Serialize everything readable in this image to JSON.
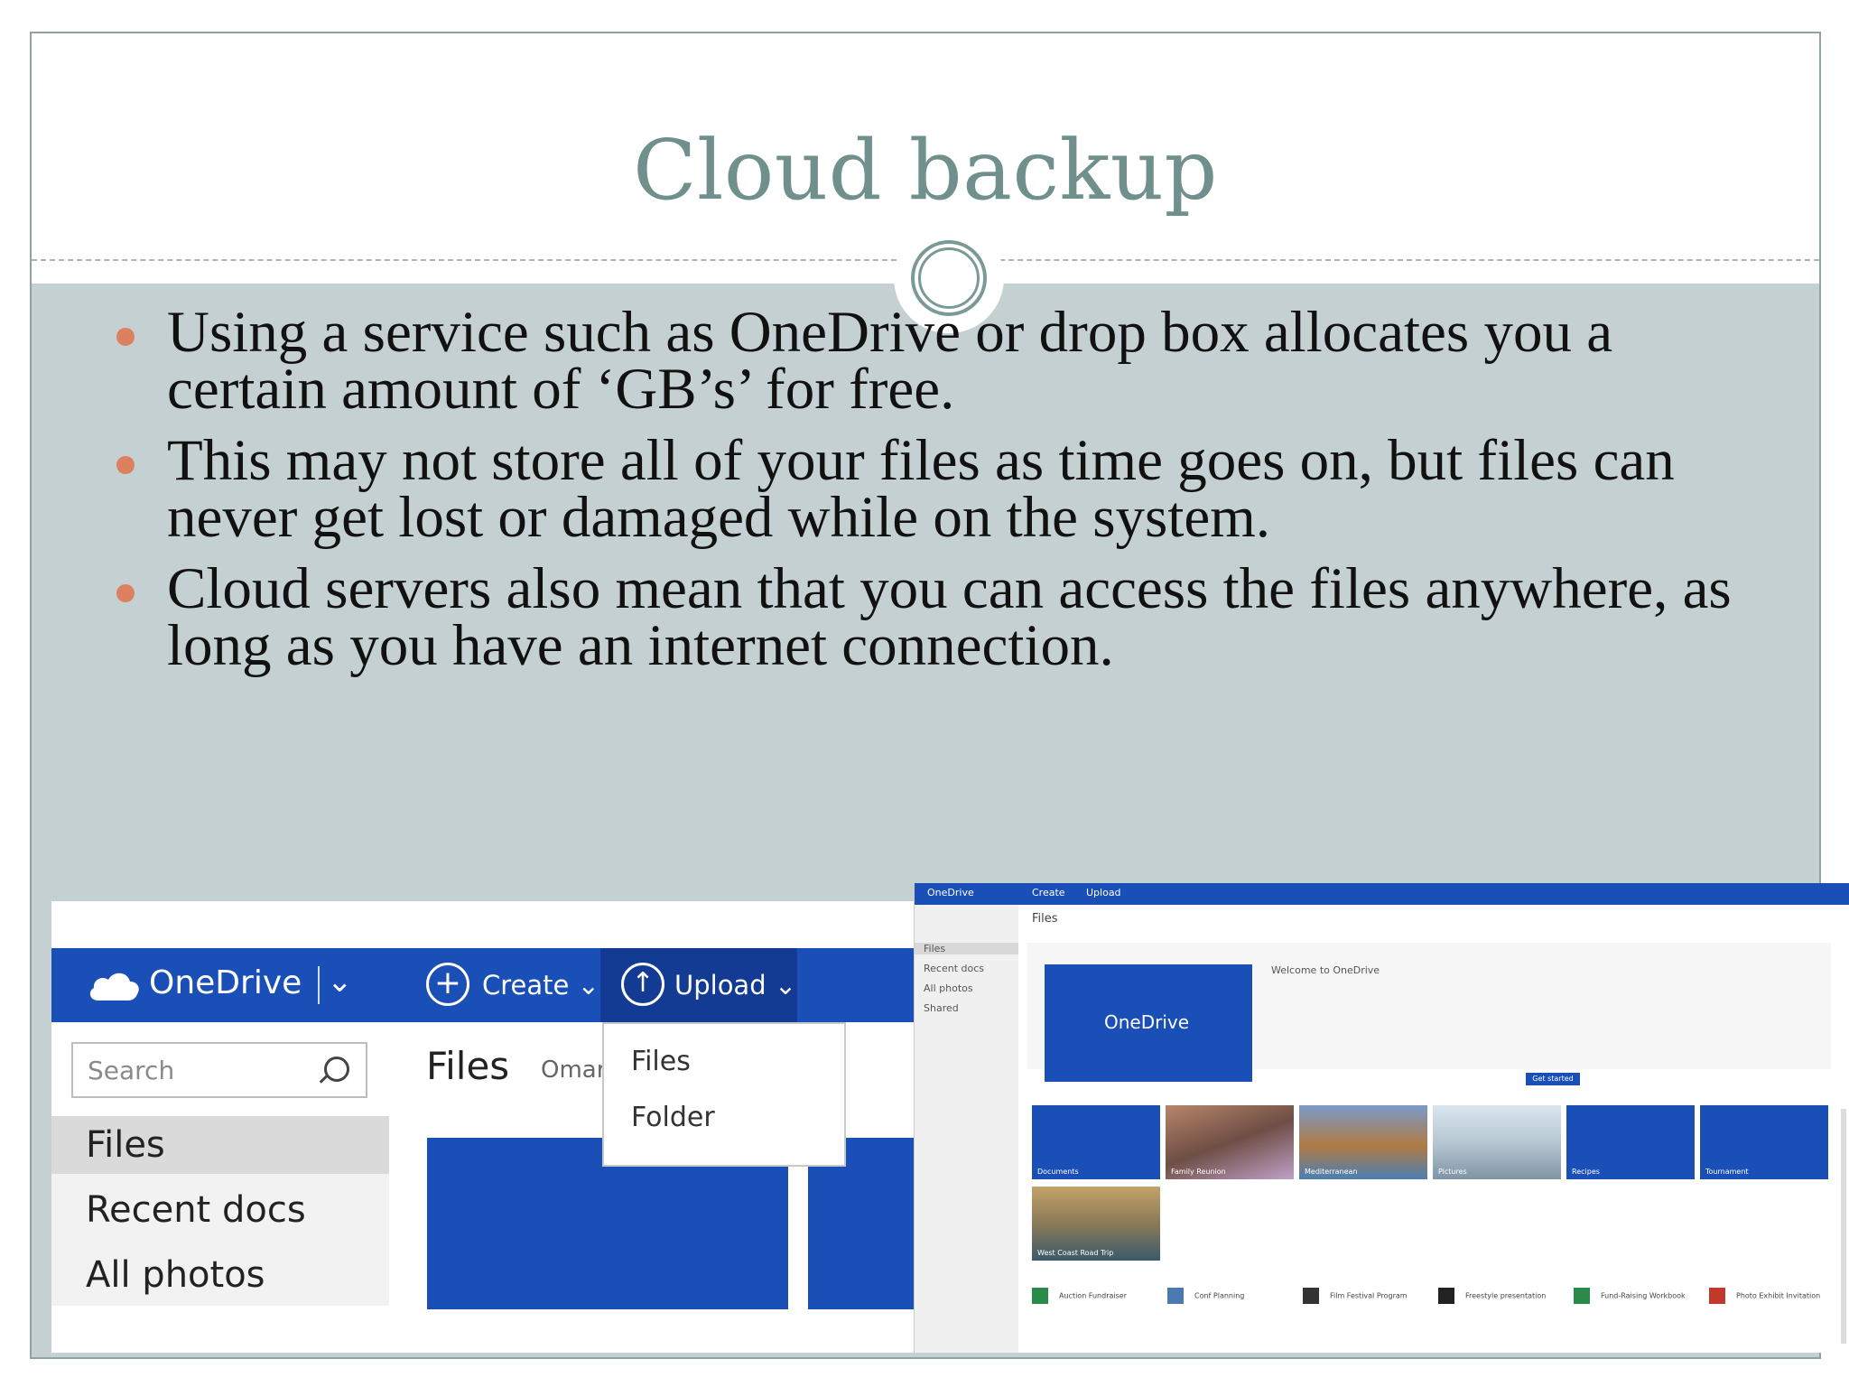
{
  "slide": {
    "title": "Cloud backup",
    "bullets": [
      "Using a service such as OneDrive or drop box allocates you a certain amount of ‘GB’s’ for free.",
      "This may not store all of your files as time goes on, but files can never get lost or damaged while on the system.",
      "Cloud servers also mean that you can access the files anywhere, as long as you have an internet connection."
    ]
  },
  "onedrive_zoom": {
    "brand": "OneDrive",
    "create_label": "Create",
    "upload_label": "Upload",
    "search_placeholder": "Search",
    "nav": [
      "Files",
      "Recent docs",
      "All photos"
    ],
    "page_title": "Files",
    "user_name": "Omar",
    "upload_menu": [
      "Files",
      "Folder"
    ]
  },
  "onedrive_full": {
    "brand": "OneDrive",
    "top_create": "Create",
    "top_upload": "Upload",
    "nav": [
      "Files",
      "Recent docs",
      "All photos",
      "Shared"
    ],
    "page_title": "Files",
    "welcome_title": "Welcome to OneDrive",
    "welcome_brand": "OneDrive",
    "get_started": "Get started",
    "tiles": [
      "Documents",
      "Family Reunion",
      "Mediterranean",
      "Pictures",
      "Recipes",
      "Tournament"
    ],
    "tile_extra": "West Coast Road Trip",
    "docs": [
      "Auction Fundraiser",
      "Conf Planning",
      "Film Festival Program",
      "Freestyle presentation",
      "Fund-Raising Workbook",
      "Photo Exhibit Invitation"
    ]
  },
  "colors": {
    "title": "#6f908c",
    "body_bg": "#c5d0d3",
    "bullet": "#dd8060",
    "onedrive_blue": "#1b4fb8"
  }
}
